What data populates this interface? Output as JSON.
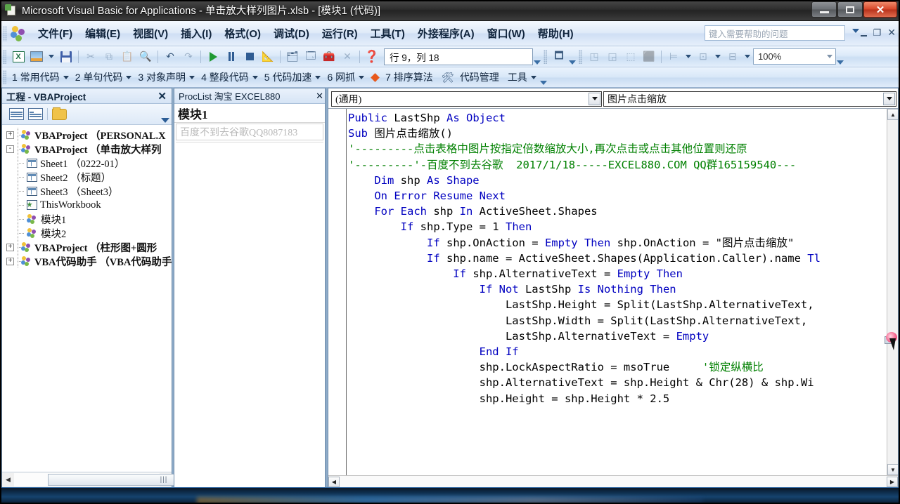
{
  "window": {
    "title": "Microsoft Visual Basic for Applications - 单击放大样列图片.xlsb - [模块1 (代码)]",
    "minimize_label": "",
    "maximize_label": "",
    "close_label": "✕"
  },
  "menubar": {
    "items": [
      {
        "label": "文件(F)"
      },
      {
        "label": "编辑(E)"
      },
      {
        "label": "视图(V)"
      },
      {
        "label": "插入(I)"
      },
      {
        "label": "格式(O)"
      },
      {
        "label": "调试(D)"
      },
      {
        "label": "运行(R)"
      },
      {
        "label": "工具(T)"
      },
      {
        "label": "外接程序(A)"
      },
      {
        "label": "窗口(W)"
      },
      {
        "label": "帮助(H)"
      }
    ],
    "help_placeholder": "键入需要帮助的问题",
    "mdi_restore": "❐",
    "mdi_close": "✕"
  },
  "toolbar": {
    "position_value": "行 9，列 18",
    "zoom_value": "100%",
    "excel_icon_text": "X",
    "icons": [
      "view-excel-icon",
      "insert-userform-icon",
      "save-icon",
      "cut-icon",
      "copy-icon",
      "paste-icon",
      "find-icon",
      "undo-icon",
      "redo-icon",
      "run-icon",
      "break-icon",
      "reset-icon",
      "design-mode-icon",
      "project-explorer-icon",
      "properties-window-icon",
      "object-browser-icon",
      "toolbox-icon",
      "help-icon"
    ]
  },
  "addin_bar": {
    "items": [
      {
        "label": "1 常用代码",
        "caret": true
      },
      {
        "label": "2 单句代码",
        "caret": true
      },
      {
        "label": "3 对象声明",
        "caret": true
      },
      {
        "label": "4 整段代码",
        "caret": true
      },
      {
        "label": "5 代码加速",
        "caret": true
      },
      {
        "label": "6 网抓",
        "caret": true
      },
      {
        "label": "7 排序算法",
        "caret": false
      },
      {
        "label": "代码管理",
        "caret": false
      },
      {
        "label": "工具",
        "caret": true
      }
    ]
  },
  "project_panel": {
    "title": "工程 - VBAProject",
    "close_label": "✕",
    "toolbar_icons": [
      "view-code-icon",
      "view-object-icon",
      "toggle-folders-icon"
    ],
    "tree": [
      {
        "label": "VBAProject （PERSONAL.X",
        "icon": "vbaproject-icon",
        "expander": "+",
        "depth": 0
      },
      {
        "label": "VBAProject （单击放大样列",
        "icon": "vbaproject-icon",
        "expander": "-",
        "depth": 0
      },
      {
        "label": "Sheet1 （0222-01）",
        "icon": "worksheet-icon",
        "expander": "",
        "depth": 1
      },
      {
        "label": "Sheet2 （标题）",
        "icon": "worksheet-icon",
        "expander": "",
        "depth": 1
      },
      {
        "label": "Sheet3 （Sheet3）",
        "icon": "worksheet-icon",
        "expander": "",
        "depth": 1
      },
      {
        "label": "ThisWorkbook",
        "icon": "workbook-icon",
        "expander": "",
        "depth": 1
      },
      {
        "label": "模块1",
        "icon": "module-icon",
        "expander": "",
        "depth": 1
      },
      {
        "label": "模块2",
        "icon": "module-icon",
        "expander": "",
        "depth": 1
      },
      {
        "label": "VBAProject （柱形图+圆形",
        "icon": "vbaproject-icon",
        "expander": "+",
        "depth": 0
      },
      {
        "label": "VBA代码助手 （VBA代码助手",
        "icon": "vbaproject-icon",
        "expander": "+",
        "depth": 0
      }
    ],
    "hscroll_thumb_label": "|||",
    "hscroll_left": "◀",
    "hscroll_right": "▶"
  },
  "proclist_panel": {
    "title": "ProcList 淘宝 EXCEL880",
    "close_label": "✕",
    "module_name": "模块1",
    "search_placeholder": "百度不到去谷歌QQ8087183"
  },
  "code_window": {
    "object_dropdown": "(通用)",
    "procedure_dropdown": "图片点击缩放",
    "lines": [
      [
        {
          "t": "Public ",
          "c": "kw"
        },
        {
          "t": "LastShp ",
          "c": "id"
        },
        {
          "t": "As ",
          "c": "kw"
        },
        {
          "t": "Object",
          "c": "kw"
        }
      ],
      [
        {
          "t": "Sub ",
          "c": "kw"
        },
        {
          "t": "图片点击缩放()",
          "c": "id"
        }
      ],
      [
        {
          "t": "'---------点击表格中图片按指定倍数缩放大小,再次点击或点击其他位置则还原",
          "c": "cm"
        }
      ],
      [
        {
          "t": "'---------'-百度不到去谷歌  2017/1/18-----EXCEL880.COM QQ群165159540---",
          "c": "cm"
        }
      ],
      [
        {
          "t": "    Dim ",
          "c": "kw"
        },
        {
          "t": "shp ",
          "c": "id"
        },
        {
          "t": "As ",
          "c": "kw"
        },
        {
          "t": "Shape",
          "c": "kw"
        }
      ],
      [
        {
          "t": "    On Error Resume Next",
          "c": "kw"
        }
      ],
      [
        {
          "t": "    For Each ",
          "c": "kw"
        },
        {
          "t": "shp ",
          "c": "id"
        },
        {
          "t": "In ",
          "c": "kw"
        },
        {
          "t": "ActiveSheet.Shapes",
          "c": "id"
        }
      ],
      [
        {
          "t": "",
          "c": "id"
        }
      ],
      [
        {
          "t": "        If ",
          "c": "kw"
        },
        {
          "t": "shp.Type = 1 ",
          "c": "id"
        },
        {
          "t": "Then",
          "c": "kw"
        }
      ],
      [
        {
          "t": "            If ",
          "c": "kw"
        },
        {
          "t": "shp.OnAction = ",
          "c": "id"
        },
        {
          "t": "Empty ",
          "c": "kw"
        },
        {
          "t": "Then ",
          "c": "kw"
        },
        {
          "t": "shp.OnAction = \"图片点击缩放\"",
          "c": "id"
        }
      ],
      [
        {
          "t": "            If ",
          "c": "kw"
        },
        {
          "t": "shp.name = ActiveSheet.Shapes(Application.Caller).name ",
          "c": "id"
        },
        {
          "t": "Tl",
          "c": "kw"
        }
      ],
      [
        {
          "t": "                If ",
          "c": "kw"
        },
        {
          "t": "shp.AlternativeText = ",
          "c": "id"
        },
        {
          "t": "Empty ",
          "c": "kw"
        },
        {
          "t": "Then",
          "c": "kw"
        }
      ],
      [
        {
          "t": "                    If Not ",
          "c": "kw"
        },
        {
          "t": "LastShp ",
          "c": "id"
        },
        {
          "t": "Is Nothing Then",
          "c": "kw"
        }
      ],
      [
        {
          "t": "                        LastShp.Height = Split(LastShp.AlternativeText,",
          "c": "id"
        }
      ],
      [
        {
          "t": "                        LastShp.Width = Split(LastShp.AlternativeText, ",
          "c": "id"
        }
      ],
      [
        {
          "t": "                        LastShp.AlternativeText = ",
          "c": "id"
        },
        {
          "t": "Empty",
          "c": "kw"
        }
      ],
      [
        {
          "t": "                    End If",
          "c": "kw"
        }
      ],
      [
        {
          "t": "                    shp.LockAspectRatio = msoTrue     ",
          "c": "id"
        },
        {
          "t": "'锁定纵横比",
          "c": "cm"
        }
      ],
      [
        {
          "t": "                    shp.AlternativeText = shp.Height & Chr(28) & shp.Wi",
          "c": "id"
        }
      ],
      [
        {
          "t": "                    shp.Height = shp.Height * 2.5",
          "c": "id"
        }
      ]
    ],
    "scroll_up": "▲",
    "scroll_down": "▼",
    "hscroll_left": "◀",
    "hscroll_right": "▶"
  }
}
